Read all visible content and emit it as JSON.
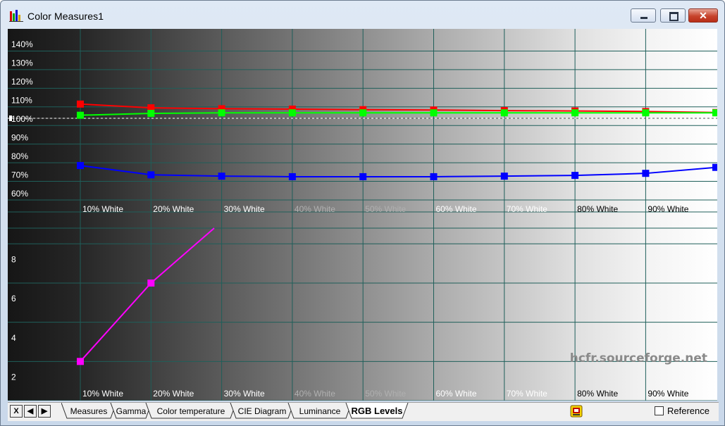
{
  "window": {
    "title": "Color Measures1",
    "close_glyph": "✕",
    "icon": "bar-chart-icon"
  },
  "chart_data": [
    {
      "type": "line",
      "categories": [
        "10% White",
        "20% White",
        "30% White",
        "40% White",
        "50% White",
        "60% White",
        "70% White",
        "80% White",
        "90% White"
      ],
      "y_tick_labels": [
        "140%",
        "130%",
        "120%",
        "110%",
        "100%",
        "90%",
        "80%",
        "70%",
        "60%"
      ],
      "ylim": [
        55,
        145
      ],
      "reference_line": 100,
      "grid": true,
      "series": [
        {
          "color": "#ff0000",
          "values": [
            106.5,
            104.5,
            104.0,
            103.8,
            103.5,
            103.3,
            103.0,
            102.8,
            102.5,
            102.0
          ]
        },
        {
          "color": "#00ff00",
          "values": [
            100.5,
            101.5,
            101.8,
            101.8,
            101.8,
            101.8,
            101.8,
            101.8,
            101.8,
            101.8
          ]
        },
        {
          "color": "#0000ff",
          "values": [
            73.5,
            68.5,
            67.8,
            67.5,
            67.5,
            67.5,
            67.8,
            68.2,
            69.3,
            72.5
          ]
        }
      ]
    },
    {
      "type": "line",
      "categories": [
        "10% White",
        "20% White",
        "30% White",
        "40% White",
        "50% White",
        "60% White",
        "70% White",
        "80% White",
        "90% White"
      ],
      "y_tick_labels": [
        "8",
        "6",
        "4",
        "2"
      ],
      "ylim": [
        0.8,
        9.6
      ],
      "grid": true,
      "series": [
        {
          "color": "#ff00ff",
          "values": [
            2.8,
            6.8
          ],
          "end_value": 9.6
        }
      ]
    }
  ],
  "watermark": "hcfr.sourceforge.net",
  "tabs": [
    "Measures",
    "Gamma",
    "Color temperature",
    "CIE Diagram",
    "Luminance",
    "RGB Levels"
  ],
  "active_tab": "RGB Levels",
  "nav_buttons": [
    "X",
    "◀",
    "▶"
  ],
  "reference_label": "Reference",
  "reference_checked": false,
  "colors": {
    "grid": "#1f5f5a",
    "plot_dark": "#1a1a1a",
    "plot_light": "#ffffff"
  }
}
